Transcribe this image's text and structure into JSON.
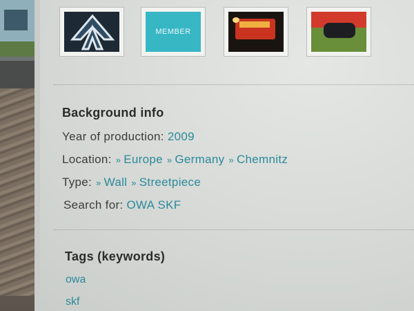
{
  "thumbnails": [
    {
      "name": "arrow"
    },
    {
      "name": "member",
      "label": "MEMBER"
    },
    {
      "name": "train"
    },
    {
      "name": "red-scene"
    }
  ],
  "background_info": {
    "title": "Background info",
    "year_label": "Year of production:",
    "year_value": "2009",
    "location_label": "Location:",
    "location_items": [
      "Europe",
      "Germany",
      "Chemnitz"
    ],
    "type_label": "Type:",
    "type_items": [
      "Wall",
      "Streetpiece"
    ],
    "search_label": "Search for:",
    "search_value": "OWA SKF"
  },
  "tags": {
    "title": "Tags (keywords)",
    "items": [
      "owa",
      "skf"
    ]
  },
  "colors": {
    "link": "#2b8a99",
    "text": "#3a3d3c",
    "background": "#d6d9d6"
  },
  "icons": {
    "breadcrumb_arrow": "double-chevron-right-icon"
  }
}
